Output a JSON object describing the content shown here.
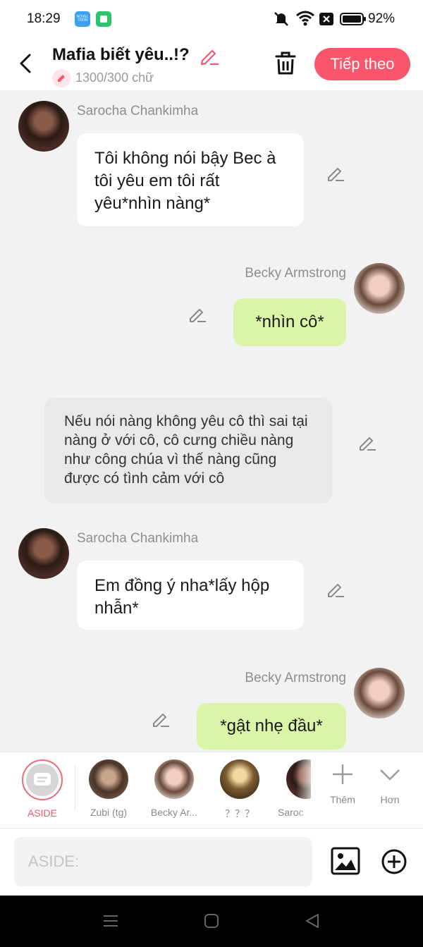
{
  "status_bar": {
    "time": "18:29",
    "novel_badge_text": "NOVEL TOON",
    "battery": "92%"
  },
  "header": {
    "title": "Mafia biết yêu..!?",
    "word_count": "1300/300 chữ",
    "next_label": "Tiếp theo"
  },
  "messages": [
    {
      "speaker": "Sarocha Chankimha",
      "text": "Tôi không nói bậy Bec à tôi yêu em tôi rất yêu*nhìn nàng*"
    },
    {
      "speaker": "Becky Armstrong",
      "text": "*nhìn cô*"
    },
    {
      "text": "Nếu nói nàng không yêu cô thì sai tại nàng ở với cô, cô cưng chiều nàng như công chúa vì thế nàng cũng được có tình cảm với cô"
    },
    {
      "speaker": "Sarocha Chankimha",
      "text": "Em đồng ý nha*lấy hộp nhẫn*"
    },
    {
      "speaker": "Becky Armstrong",
      "text": "*gật nhẹ đầu*"
    }
  ],
  "characters": [
    {
      "label": "ASIDE"
    },
    {
      "label": "Zubi (tg)"
    },
    {
      "label": "Becky Ar..."
    },
    {
      "label": "？？？"
    },
    {
      "label": "Saroc"
    }
  ],
  "tools": {
    "add_label": "Thêm",
    "more_label": "Hơn"
  },
  "input": {
    "placeholder": "ASIDE:"
  },
  "colors": {
    "accent": "#f9566b",
    "self_bubble": "#dbf5a8",
    "other_bubble": "#ffffff",
    "aside_bubble": "#e9e9e9"
  }
}
